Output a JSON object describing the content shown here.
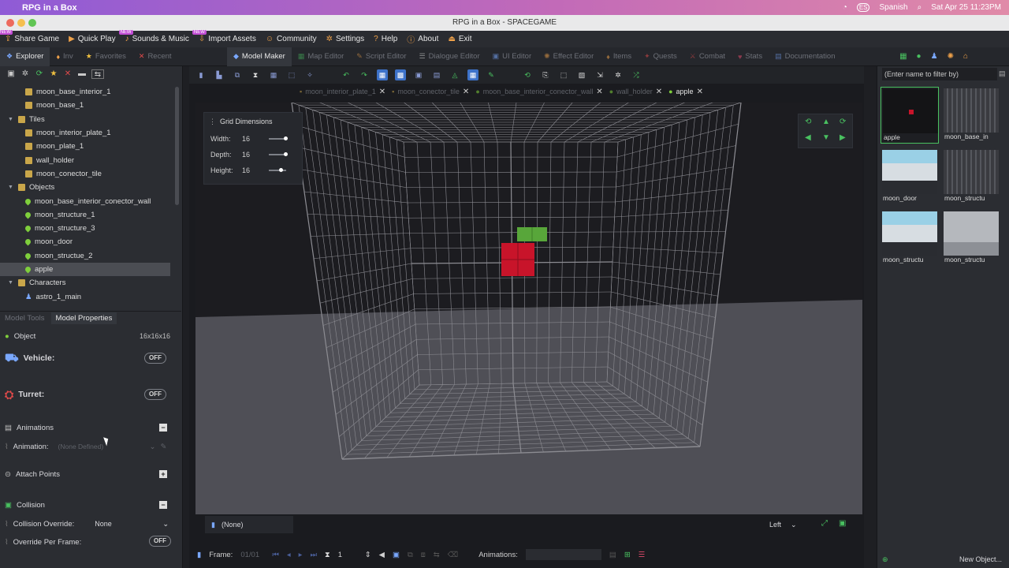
{
  "macbar": {
    "app_name": "RPG in a Box",
    "input_source": "Spanish",
    "input_badge": "ES",
    "datetime": "Sat Apr 25  11:23PM"
  },
  "window": {
    "title": "RPG in a Box - SPACEGAME"
  },
  "app_menu": {
    "new_badge": "NEW",
    "items": [
      {
        "label": "Share Game",
        "icon": "share-icon",
        "new": true
      },
      {
        "label": "Quick Play",
        "icon": "play-icon",
        "new": false
      },
      {
        "label": "Sounds & Music",
        "icon": "music-icon",
        "new": true
      },
      {
        "label": "Import Assets",
        "icon": "import-icon",
        "new": true
      },
      {
        "label": "Community",
        "icon": "community-icon",
        "new": false
      },
      {
        "label": "Settings",
        "icon": "settings-icon",
        "new": false
      },
      {
        "label": "Help",
        "icon": "help-icon",
        "new": false
      },
      {
        "label": "About",
        "icon": "info-icon",
        "new": false
      },
      {
        "label": "Exit",
        "icon": "exit-icon",
        "new": false
      }
    ]
  },
  "left_tabs": [
    {
      "label": "Explorer",
      "active": true
    },
    {
      "label": "Inv",
      "active": false
    },
    {
      "label": "Favorites",
      "active": false
    },
    {
      "label": "Recent",
      "active": false
    }
  ],
  "editor_tabs": [
    {
      "label": "Model Maker",
      "active": true
    },
    {
      "label": "Map Editor",
      "active": false
    },
    {
      "label": "Script Editor",
      "active": false
    },
    {
      "label": "Dialogue Editor",
      "active": false
    },
    {
      "label": "UI Editor",
      "active": false
    },
    {
      "label": "Effect Editor",
      "active": false
    },
    {
      "label": "Items",
      "active": false
    },
    {
      "label": "Quests",
      "active": false
    },
    {
      "label": "Combat",
      "active": false
    },
    {
      "label": "Stats",
      "active": false
    },
    {
      "label": "Documentation",
      "active": false
    }
  ],
  "tree": [
    {
      "label": "moon_base_interior_1",
      "type": "file",
      "indent": 2
    },
    {
      "label": "moon_base_1",
      "type": "file",
      "indent": 2
    },
    {
      "label": "Tiles",
      "type": "folder",
      "indent": 1
    },
    {
      "label": "moon_interior_plate_1",
      "type": "file",
      "indent": 2
    },
    {
      "label": "moon_plate_1",
      "type": "file",
      "indent": 2
    },
    {
      "label": "wall_holder",
      "type": "file",
      "indent": 2
    },
    {
      "label": "moon_conector_tile",
      "type": "file",
      "indent": 2
    },
    {
      "label": "Objects",
      "type": "folder",
      "indent": 1
    },
    {
      "label": "moon_base_interior_conector_wall",
      "type": "object",
      "indent": 2
    },
    {
      "label": "moon_structure_1",
      "type": "object",
      "indent": 2
    },
    {
      "label": "moon_structure_3",
      "type": "object",
      "indent": 2
    },
    {
      "label": "moon_door",
      "type": "object",
      "indent": 2
    },
    {
      "label": "moon_structue_2",
      "type": "object",
      "indent": 2
    },
    {
      "label": "apple",
      "type": "object",
      "indent": 2,
      "selected": true
    },
    {
      "label": "Characters",
      "type": "folder",
      "indent": 1
    },
    {
      "label": "astro_1_main",
      "type": "character",
      "indent": 2
    }
  ],
  "prop_tabs": {
    "model_tools": "Model Tools",
    "model_properties": "Model Properties"
  },
  "properties": {
    "object_label": "Object",
    "size": "16x16x16",
    "vehicle_label": "Vehicle:",
    "vehicle_toggle": "OFF",
    "turret_label": "Turret:",
    "turret_toggle": "OFF",
    "animations_label": "Animations",
    "animation_field_label": "Animation:",
    "animation_value": "(None Defined)",
    "attach_points_label": "Attach Points",
    "collision_label": "Collision",
    "collision_override_label": "Collision Override:",
    "collision_override_value": "None",
    "override_per_frame_label": "Override Per Frame:",
    "override_per_frame_toggle": "OFF"
  },
  "doc_tabs": [
    {
      "label": "moon_interior_plate_1",
      "active": false,
      "closable": true
    },
    {
      "label": "moon_conector_tile",
      "active": false,
      "closable": true
    },
    {
      "label": "moon_base_interior_conector_wall",
      "active": false,
      "closable": true
    },
    {
      "label": "wall_holder",
      "active": false,
      "closable": true
    },
    {
      "label": "apple",
      "active": true,
      "closable": true
    }
  ],
  "grid_dimensions": {
    "title": "Grid Dimensions",
    "width_label": "Width:",
    "width": "16",
    "depth_label": "Depth:",
    "depth": "16",
    "height_label": "Height:",
    "height": "16"
  },
  "viewport_bottom": {
    "layer_value": "(None)",
    "view_select": "Left",
    "frame_label": "Frame:",
    "frame_counter": "01/01",
    "frame_step": "1",
    "animations_label": "Animations:"
  },
  "right_panel": {
    "filter_placeholder": "(Enter name to filter by)",
    "thumbnails": [
      {
        "label": "apple",
        "selected": true
      },
      {
        "label": "moon_base_in"
      },
      {
        "label": "moon_door"
      },
      {
        "label": "moon_structu"
      },
      {
        "label": "moon_structu"
      },
      {
        "label": "moon_structu"
      }
    ],
    "new_object": "New Object..."
  },
  "colors": {
    "accent_blue": "#3d72c9",
    "accent_green": "#49c160",
    "apple_red": "#c8142a",
    "apple_green": "#58a63a"
  }
}
